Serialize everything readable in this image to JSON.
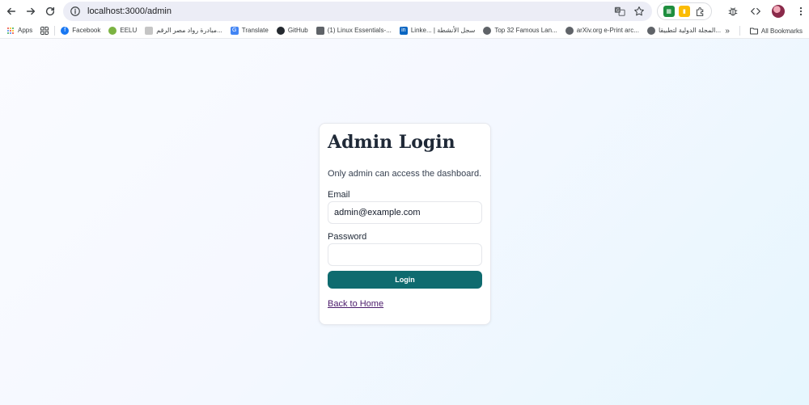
{
  "browser": {
    "url": "localhost:3000/admin",
    "bookmarks": [
      {
        "label": "Apps",
        "icon": "apps-grid-icon"
      },
      {
        "label": "",
        "icon": "grid-icon"
      },
      {
        "label": "Facebook",
        "icon": "facebook-icon"
      },
      {
        "label": "EELU",
        "icon": "eelu-icon"
      },
      {
        "label": "مبادرة رواد مصر الرقم...",
        "icon": "initiative-icon"
      },
      {
        "label": "Translate",
        "icon": "translate-icon"
      },
      {
        "label": "GitHub",
        "icon": "github-icon"
      },
      {
        "label": "(1) Linux Essentials-...",
        "icon": "keyboard-icon"
      },
      {
        "label": "Linke... | سجل الأنشطة",
        "icon": "linkedin-icon"
      },
      {
        "label": "Top 32 Famous Lan...",
        "icon": "globe-icon"
      },
      {
        "label": "arXiv.org e-Print arc...",
        "icon": "globe-icon"
      },
      {
        "label": "المجلة الدولية لتطبيقا...",
        "icon": "globe-icon"
      }
    ],
    "overflow_label": "»",
    "all_bookmarks_label": "All Bookmarks"
  },
  "login": {
    "title": "Admin Login",
    "subtitle": "Only admin can access the dashboard.",
    "email_label": "Email",
    "email_value": "admin@example.com",
    "password_label": "Password",
    "password_value": "",
    "login_button": "Login",
    "back_link": "Back to Home"
  },
  "colors": {
    "button": "#0f6b6f",
    "link": "#4b1b6b",
    "title": "#1f2937"
  }
}
